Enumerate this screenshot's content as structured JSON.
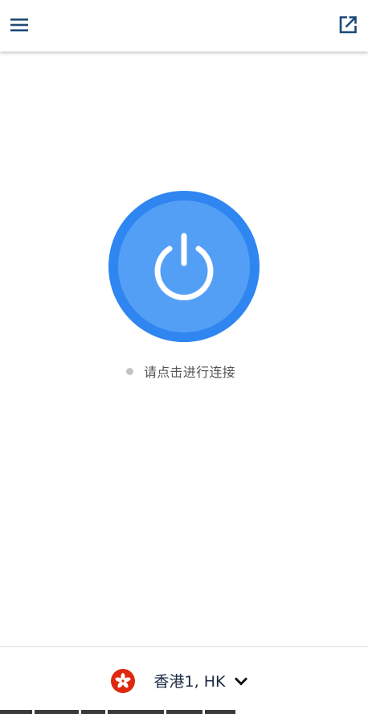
{
  "header": {
    "menu_icon": "hamburger-menu-icon",
    "open_icon": "open-external-icon"
  },
  "connection": {
    "power_icon": "power-icon",
    "status_text": "请点击进行连接",
    "status_color": "#c4c4c4",
    "button_outer_color": "#2f86f0",
    "button_inner_color": "#549ff6"
  },
  "server": {
    "flag_icon": "hong-kong-flag-icon",
    "name": "香港1, HK",
    "dropdown_icon": "chevron-down-icon"
  },
  "colors": {
    "accent": "#2f86f0",
    "navy": "#1d4a78",
    "flag_red": "#de2910"
  }
}
